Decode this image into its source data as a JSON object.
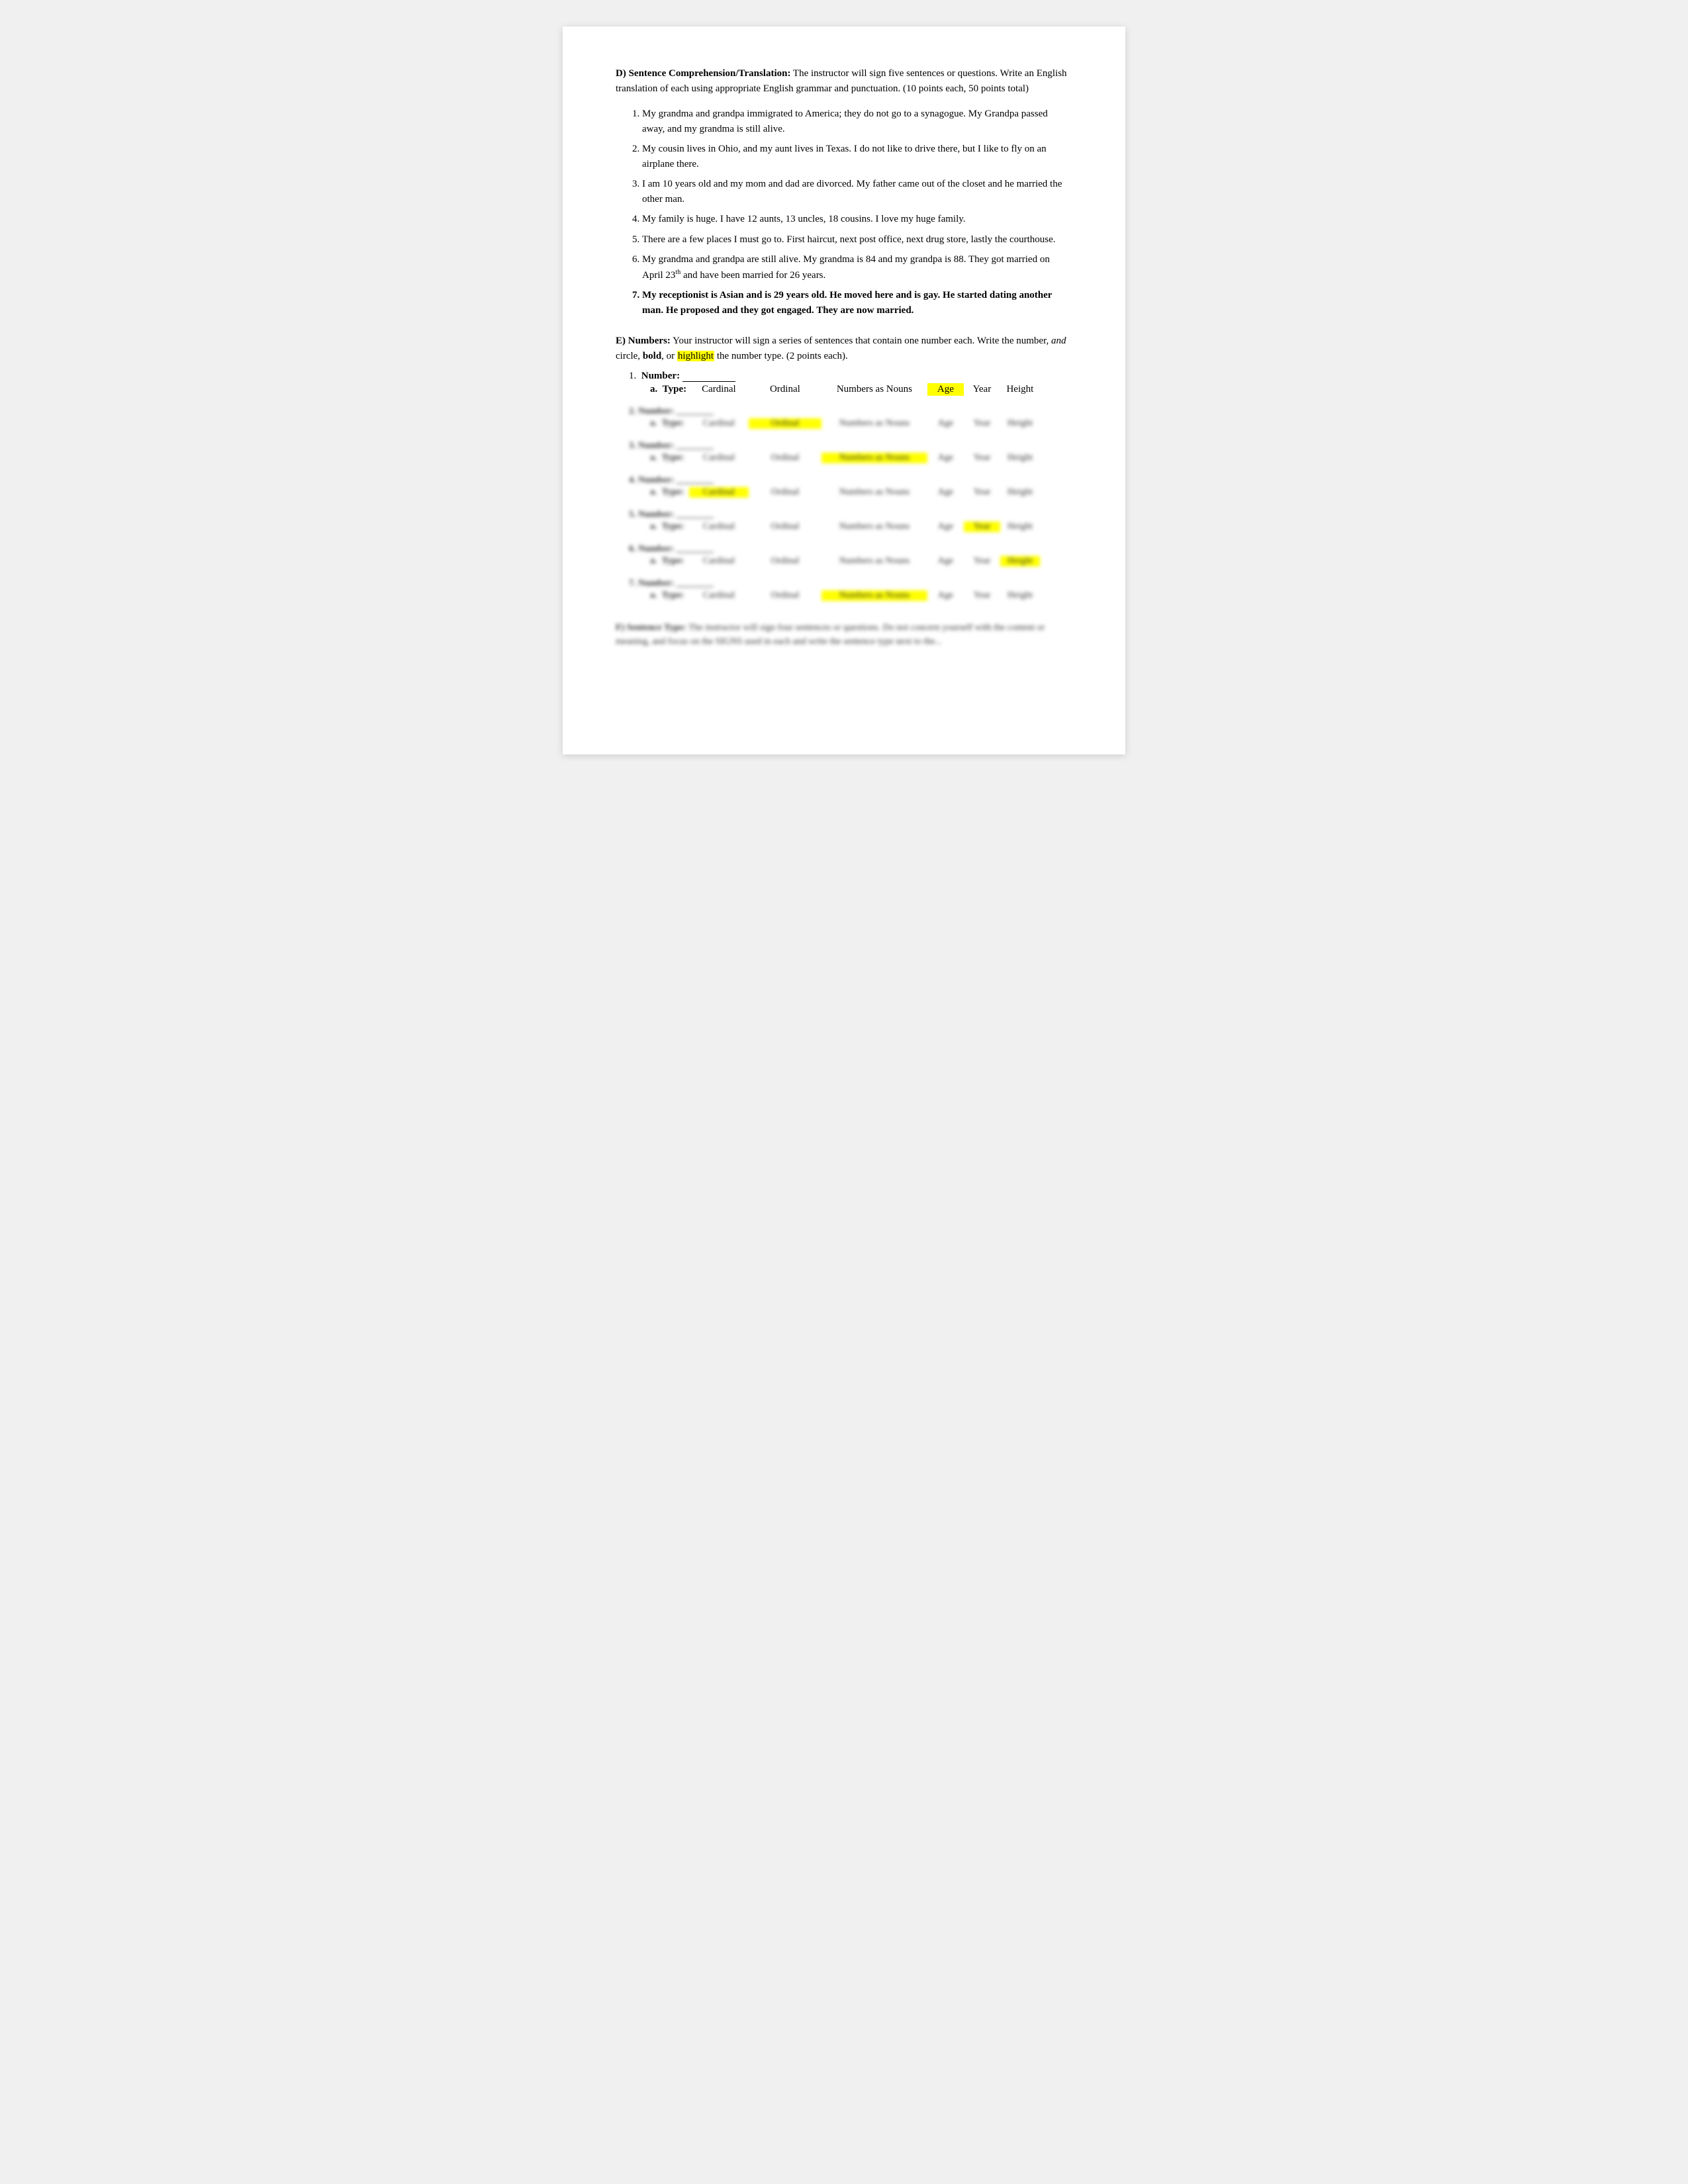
{
  "page": {
    "section_d": {
      "heading": "D) Sentence Comprehension/Translation:",
      "intro": " The instructor will sign five sentences or questions. Write an English translation of each using appropriate English grammar and punctuation. (10 points each, 50 points total)",
      "items": [
        {
          "id": 1,
          "text": "My grandma and grandpa immigrated to America; they do not go to a synagogue. My Grandpa passed away, and my grandma is still alive."
        },
        {
          "id": 2,
          "text": "My cousin lives in Ohio, and my aunt lives in Texas. I do not like to drive there, but I like to fly on an airplane there."
        },
        {
          "id": 3,
          "text": "I am 10 years old and my mom and dad are divorced. My father came out of the closet and he married the other man."
        },
        {
          "id": 4,
          "text": "My family is huge. I have 12 aunts, 13 uncles, 18 cousins. I love my huge family."
        },
        {
          "id": 5,
          "text": "There are a few places I must go to. First haircut, next post office, next drug store, lastly the courthouse."
        },
        {
          "id": 6,
          "text_before_sup": "My grandma and grandpa are still alive. My grandma is 84 and my grandpa is 88. They got married on April 23",
          "sup": "th",
          "text_after_sup": " and have been married for 26 years."
        },
        {
          "id": 7,
          "bold": true,
          "text": "My receptionist is Asian and is 29 years old. He moved here and is gay. He started dating another man. He proposed and they got engaged. They are now married."
        }
      ]
    },
    "section_e": {
      "heading": "E) Numbers:",
      "intro_before_highlight": " Your instructor will sign a series of sentences that contain one number each. Write the number, ",
      "and_italic": "and",
      "intro_circle_bold": " circle, ",
      "bold_text": "bold",
      "intro_or": ", or ",
      "highlight_word": "highlight",
      "intro_after": " the number type. (2 points each).",
      "first_item": {
        "label": "Number:",
        "blank": "________"
      },
      "type_row": {
        "label": "Type:",
        "options": [
          {
            "name": "Cardinal",
            "highlighted": false
          },
          {
            "name": "Ordinal",
            "highlighted": false
          },
          {
            "name": "Numbers as Nouns",
            "highlighted": false
          },
          {
            "name": "Age",
            "highlighted": true
          },
          {
            "name": "Year",
            "highlighted": false
          },
          {
            "name": "Height",
            "highlighted": false
          }
        ]
      },
      "blurred_rows": [
        {
          "id": 2,
          "highlighted_col": "ordinal"
        },
        {
          "id": 3,
          "highlighted_col": "nouns"
        },
        {
          "id": 4,
          "highlighted_col": "cardinal"
        },
        {
          "id": 5,
          "highlighted_col": "year"
        },
        {
          "id": 6,
          "highlighted_col": "height"
        },
        {
          "id": 7,
          "highlighted_col": "nouns"
        }
      ]
    },
    "section_f_blurred": {
      "heading": "F) Sentence Type:",
      "text": " The instructor will sign four sentences or questions. Do not concern yourself with the content or meaning, and focus on the SIGNS used in each and write the sentence type next to the..."
    }
  }
}
